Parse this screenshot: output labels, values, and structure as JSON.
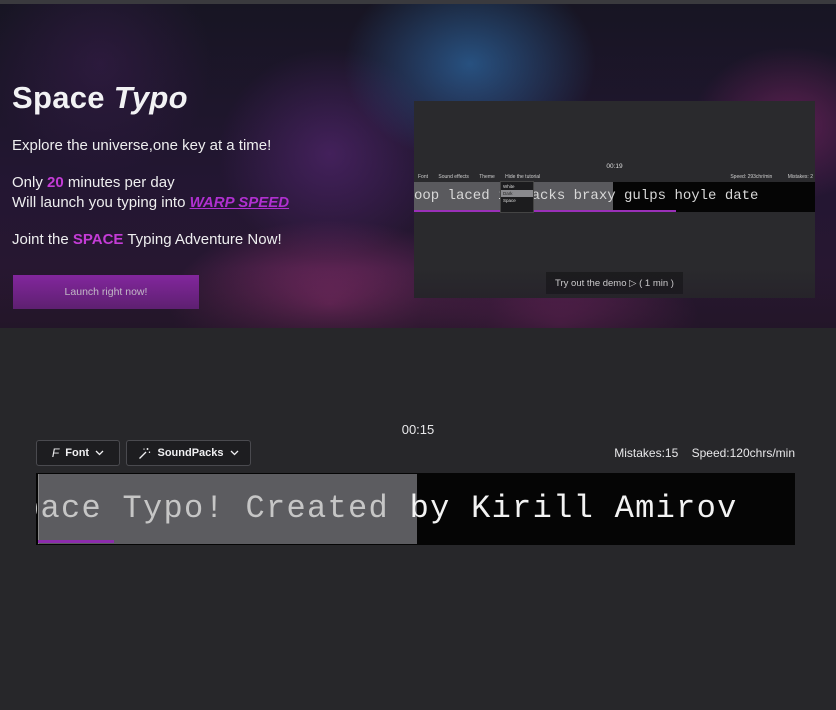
{
  "hero": {
    "title_main": "Space",
    "title_italic": "Typo",
    "tagline": "Explore the universe,one key at a time!",
    "line2_prefix": "Only ",
    "line2_number": "20",
    "line2_suffix": " minutes per day",
    "line3_prefix": "Will launch you typing into ",
    "line3_highlight": "WARP SPEED",
    "line4_prefix": "Joint the ",
    "line4_highlight": "SPACE",
    "line4_suffix": " Typing Adventure Now!",
    "launch_button": "Launch right now!"
  },
  "preview": {
    "timer": "00:19",
    "toolbar": [
      "Font",
      "Sound effects",
      "Theme",
      "Hide the tutorial"
    ],
    "speed": "Speed: 293chr/min",
    "mistakes": "Mistakes: 2",
    "text": "oop laced   ia tacks braxy gulps hoyle date",
    "theme_options": [
      "White",
      "Dark",
      "Space"
    ],
    "demo_button": "Try out the demo ▷ ( 1 min )"
  },
  "app": {
    "timer": "00:15",
    "font_button": "Font",
    "sound_button": "SoundPacks",
    "mistakes": "Mistakes:15",
    "speed": "Speed:120chrs/min",
    "typed_text": "pace Typo! Created",
    "remaining_text": " by Kirill Amirov",
    "progress": 0.1
  },
  "colors": {
    "accent": "#c43cd6",
    "button": "#8a28a6",
    "background": "#27272a",
    "typebox": "#050505"
  },
  "icons": {
    "font": "font-icon",
    "sound": "magic-wand-icon",
    "dropdown": "chevron-down-icon"
  }
}
